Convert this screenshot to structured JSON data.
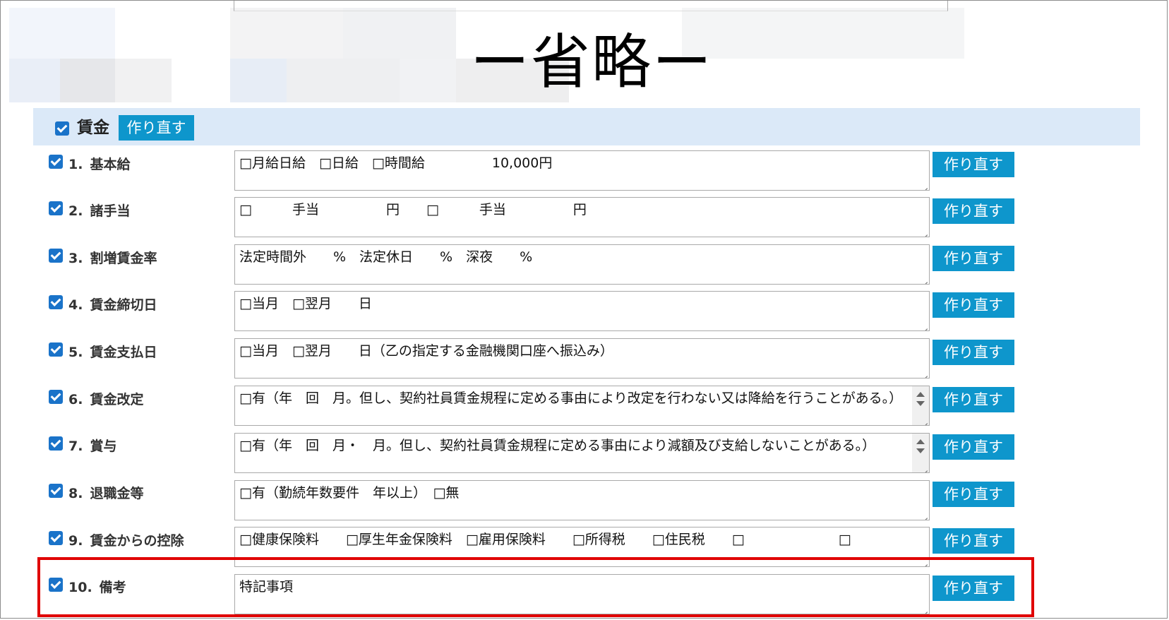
{
  "omitted_label": "ー省略ー",
  "section": {
    "title": "賃金",
    "redo_label": "作り直す",
    "checked": true
  },
  "items": [
    {
      "num": "1.",
      "label": "基本給",
      "value": "□月給日給　□日給　□時間給　　　　　10,000円",
      "checked": true,
      "redo_label": "作り直す"
    },
    {
      "num": "2.",
      "label": "諸手当",
      "value": "□　　　手当　　　　　円　　□　　　手当　　　　　円",
      "checked": true,
      "redo_label": "作り直す"
    },
    {
      "num": "3.",
      "label": "割増賃金率",
      "value": "法定時間外　　%　法定休日　　%　深夜　　%",
      "checked": true,
      "redo_label": "作り直す"
    },
    {
      "num": "4.",
      "label": "賃金締切日",
      "value": "□当月　□翌月　　日",
      "checked": true,
      "redo_label": "作り直す"
    },
    {
      "num": "5.",
      "label": "賃金支払日",
      "value": "□当月　□翌月　　日（乙の指定する金融機関口座へ振込み）",
      "checked": true,
      "redo_label": "作り直す"
    },
    {
      "num": "6.",
      "label": "賃金改定",
      "value": "□有（年　回　月。但し、契約社員賃金規程に定める事由により改定を行わない又は降給を行うことがある。）",
      "checked": true,
      "redo_label": "作り直す"
    },
    {
      "num": "7.",
      "label": "賞与",
      "value": "□有（年　回　月・　月。但し、契約社員賃金規程に定める事由により減額及び支給しないことがある。）",
      "checked": true,
      "redo_label": "作り直す"
    },
    {
      "num": "8.",
      "label": "退職金等",
      "value": "□有（勤続年数要件　年以上）　□無",
      "checked": true,
      "redo_label": "作り直す"
    },
    {
      "num": "9.",
      "label": "賃金からの控除",
      "value": "□健康保険料　　□厚生年金保険料　□雇用保険料　　□所得税　　□住民税　　□　　　　　　　□",
      "checked": true,
      "redo_label": "作り直す"
    },
    {
      "num": "10.",
      "label": "備考",
      "value": "特記事項",
      "checked": true,
      "redo_label": "作り直す"
    }
  ]
}
